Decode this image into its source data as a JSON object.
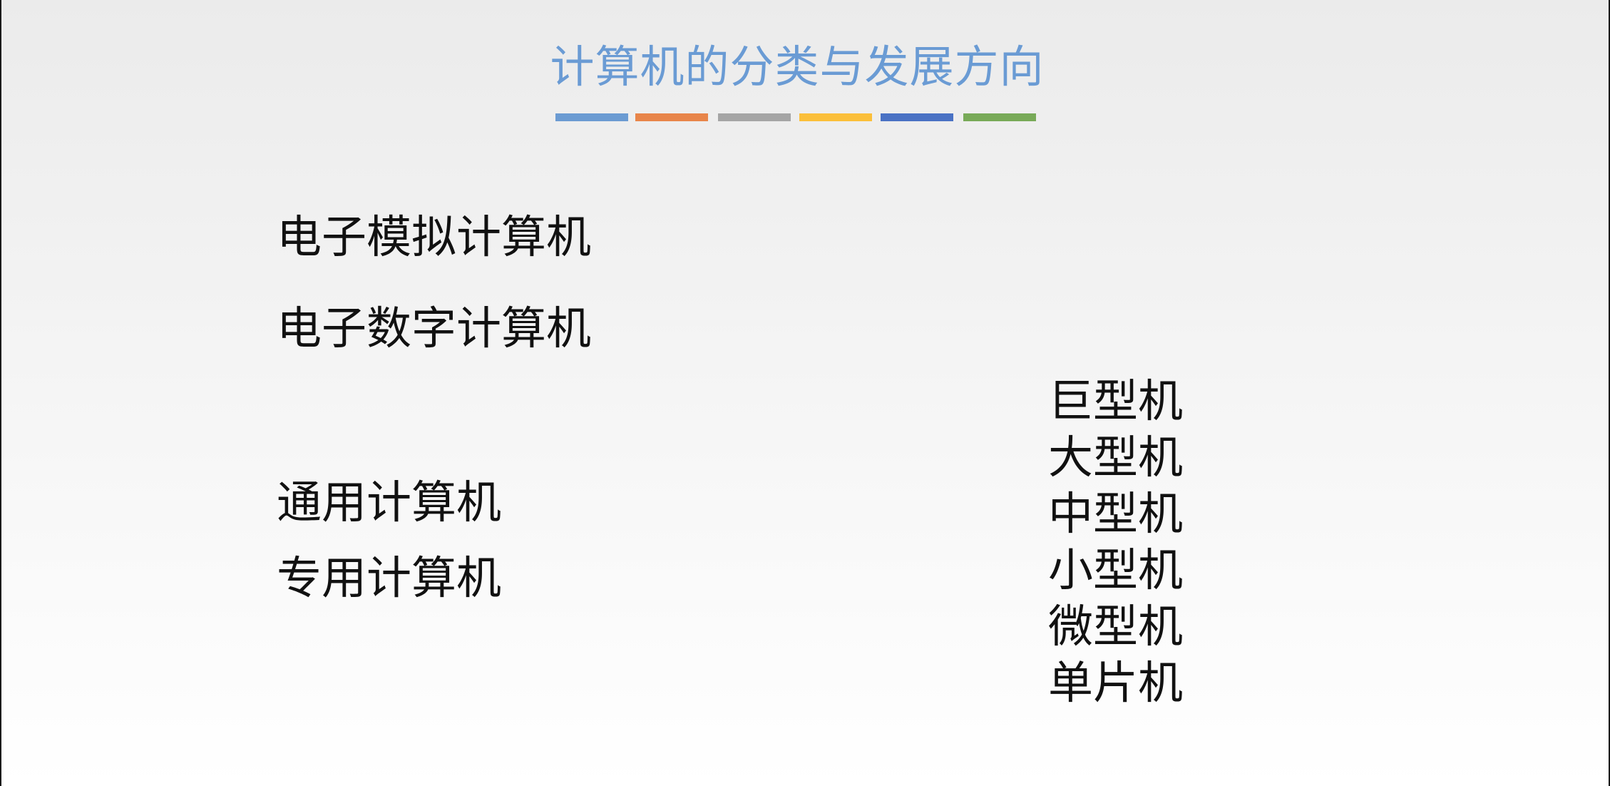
{
  "slide": {
    "title": "计算机的分类与发展方向",
    "color_bars": [
      "#6b9bd2",
      "#e8854a",
      "#a5a5a5",
      "#fbbf3a",
      "#4a72c4",
      "#78aa58"
    ],
    "left_items": [
      "电子模拟计算机",
      "电子数字计算机",
      "通用计算机",
      "专用计算机"
    ],
    "right_items": [
      "巨型机",
      "大型机",
      "中型机",
      "小型机",
      "微型机",
      "单片机"
    ]
  }
}
